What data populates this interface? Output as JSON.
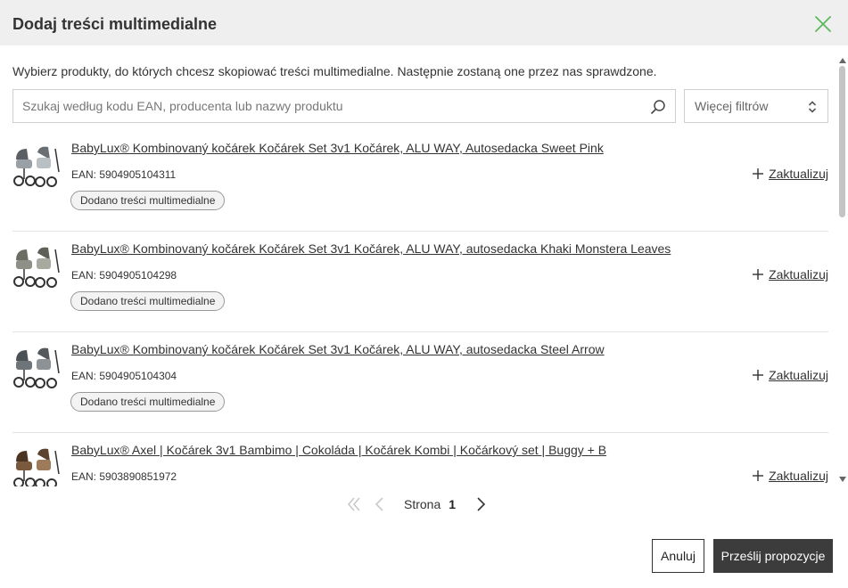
{
  "dialog": {
    "title": "Dodaj treści multimedialne",
    "close_icon": "close-icon",
    "accent_color": "#5cb85c"
  },
  "instructions": "Wybierz produkty, do których chcesz skopiować treści multimedialne. Następnie zostaną one przez nas sprawdzone.",
  "search": {
    "placeholder": "Szukaj według kodu EAN, producenta lub nazwy produktu",
    "value": "",
    "icon": "search-icon"
  },
  "filters": {
    "label": "Więcej filtrów",
    "icon": "sort-arrows-icon"
  },
  "products": [
    {
      "name": "BabyLux® Kombinovaný kočárek Kočárek Set 3v1 Kočárek, ALU WAY, Autosedacka Sweet Pink",
      "ean": "EAN: 5904905104311",
      "badge": "Dodano treści multimedialne",
      "action": "Zaktualizuj",
      "thumb_color": "#9aa1a6"
    },
    {
      "name": "BabyLux® Kombinovaný kočárek Kočárek Set 3v1 Kočárek, ALU WAY, autosedacka Khaki Monstera Leaves",
      "ean": "EAN: 5904905104298",
      "badge": "Dodano treści multimedialne",
      "action": "Zaktualizuj",
      "thumb_color": "#8e8f86"
    },
    {
      "name": "BabyLux® Kombinovaný kočárek Kočárek Set 3v1 Kočárek, ALU WAY, autosedacka Steel Arrow",
      "ean": "EAN: 5904905104304",
      "badge": "Dodano treści multimedialne",
      "action": "Zaktualizuj",
      "thumb_color": "#6f7478"
    },
    {
      "name": "BabyLux® Axel | Kočárek 3v1 Bambimo | Cokoláda | Kočárek Kombi | Kočárkový set | Buggy + B",
      "ean": "EAN: 5903890851972",
      "badge": "",
      "action": "Zaktualizuj",
      "thumb_color": "#7a5a3e"
    }
  ],
  "pagination": {
    "label": "Strona",
    "current": "1"
  },
  "footer": {
    "cancel_label": "Anuluj",
    "submit_label": "Prześlij propozycje"
  }
}
